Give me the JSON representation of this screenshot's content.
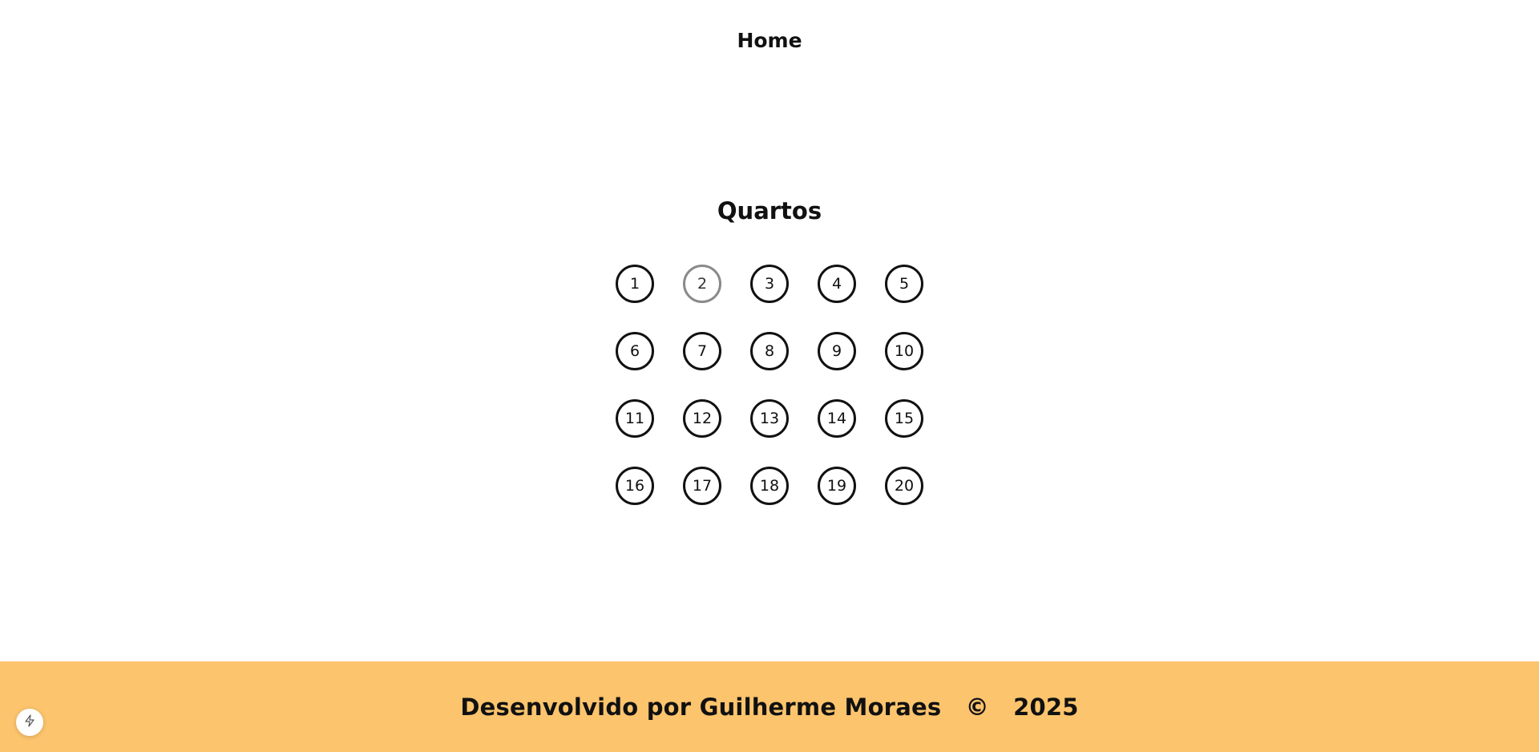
{
  "nav": {
    "home_label": "Home"
  },
  "main": {
    "title": "Quartos",
    "rooms": [
      {
        "label": "1",
        "state": "normal"
      },
      {
        "label": "2",
        "state": "muted"
      },
      {
        "label": "3",
        "state": "normal"
      },
      {
        "label": "4",
        "state": "normal"
      },
      {
        "label": "5",
        "state": "normal"
      },
      {
        "label": "6",
        "state": "normal"
      },
      {
        "label": "7",
        "state": "normal"
      },
      {
        "label": "8",
        "state": "normal"
      },
      {
        "label": "9",
        "state": "normal"
      },
      {
        "label": "10",
        "state": "normal"
      },
      {
        "label": "11",
        "state": "normal"
      },
      {
        "label": "12",
        "state": "normal"
      },
      {
        "label": "13",
        "state": "normal"
      },
      {
        "label": "14",
        "state": "normal"
      },
      {
        "label": "15",
        "state": "normal"
      },
      {
        "label": "16",
        "state": "normal"
      },
      {
        "label": "17",
        "state": "normal"
      },
      {
        "label": "18",
        "state": "normal"
      },
      {
        "label": "19",
        "state": "normal"
      },
      {
        "label": "20",
        "state": "normal"
      }
    ]
  },
  "footer": {
    "text": "Desenvolvido por Guilherme Moraes",
    "copyright_symbol": "©",
    "year": "2025"
  },
  "floating_button": {
    "icon": "lightning-icon"
  },
  "colors": {
    "footer_bg": "#fcc46d",
    "border": "#111111",
    "muted_border": "#8a8a8a"
  }
}
